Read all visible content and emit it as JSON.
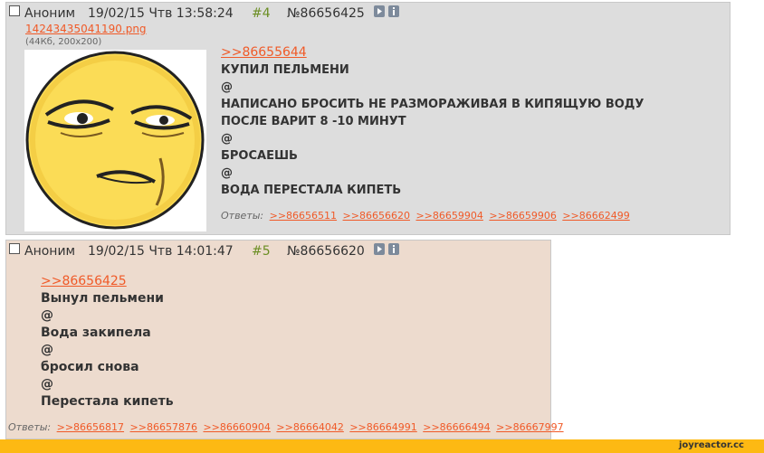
{
  "posts": [
    {
      "author": "Аноним",
      "datetime": "19/02/15 Чтв 13:58:24",
      "number": "#4",
      "id": "№86656425",
      "file_name": "14243435041190.png",
      "file_info": "(44Кб, 200x200)",
      "lines": [
        ">>86655644",
        "КУПИЛ ПЕЛЬМЕНИ",
        "@",
        "НАПИСАНО БРОСИТЬ НЕ РАЗМОРАЖИВАЯ В КИПЯЩУЮ ВОДУ",
        "ПОСЛЕ ВАРИТ 8 -10 МИНУТ",
        "@",
        "БРОСАЕШЬ",
        "@",
        "ВОДА ПЕРЕСТАЛА КИПЕТЬ"
      ],
      "replies_label": "Ответы:",
      "replies": [
        ">>86656511",
        ">>86656620",
        ">>86659904",
        ">>86659906",
        ">>86662499"
      ]
    },
    {
      "author": "Аноним",
      "datetime": "19/02/15 Чтв 14:01:47",
      "number": "#5",
      "id": "№86656620",
      "lines": [
        ">>86656425",
        "Вынул пельмени",
        "@",
        "Вода закипела",
        "@",
        "бросил снова",
        "@",
        "Перестала кипеть"
      ],
      "replies_label": "Ответы:",
      "replies": [
        ">>86656817",
        ">>86657876",
        ">>86660904",
        ">>86664042",
        ">>86664991",
        ">>86666494",
        ">>86667997"
      ]
    }
  ],
  "footer": {
    "brand": "joyreactor.cc"
  },
  "colors": {
    "post1_bg": "#dddddd",
    "post2_bg": "#eddbce",
    "link": "#f05a28",
    "post_number": "#6b8e23",
    "footer": "#fdb913"
  },
  "icons": [
    "play-icon",
    "info-icon"
  ]
}
